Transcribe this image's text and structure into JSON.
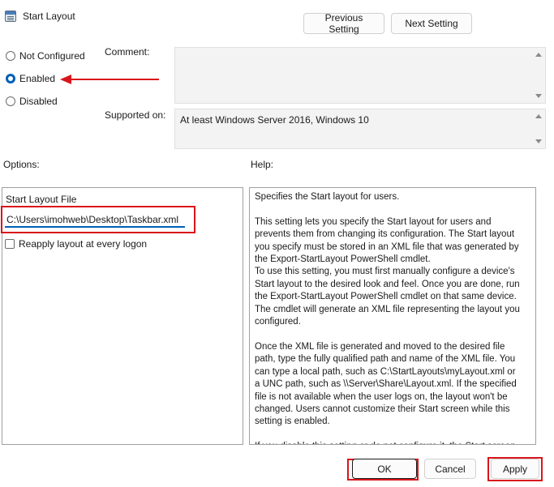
{
  "window": {
    "title": "Start Layout"
  },
  "nav": {
    "previous_label": "Previous Setting",
    "next_label": "Next Setting"
  },
  "state": {
    "options": [
      {
        "label": "Not Configured",
        "checked": false
      },
      {
        "label": "Enabled",
        "checked": true
      },
      {
        "label": "Disabled",
        "checked": false
      }
    ]
  },
  "comment": {
    "label": "Comment:",
    "value": ""
  },
  "supported": {
    "label": "Supported on:",
    "value": "At least Windows Server 2016, Windows 10"
  },
  "options_section": {
    "header": "Options:",
    "file_label": "Start Layout File",
    "file_value": "C:\\Users\\imohweb\\Desktop\\Taskbar.xml",
    "reapply_label": "Reapply layout at every logon"
  },
  "help_section": {
    "header": "Help:",
    "text": "Specifies the Start layout for users.\n\nThis setting lets you specify the Start layout for users and prevents them from changing its configuration. The Start layout you specify must be stored in an XML file that was generated by the Export-StartLayout PowerShell cmdlet.\nTo use this setting, you must first manually configure a device's Start layout to the desired look and feel. Once you are done, run the Export-StartLayout PowerShell cmdlet on that same device. The cmdlet will generate an XML file representing the layout you configured.\n\nOnce the XML file is generated and moved to the desired file path, type the fully qualified path and name of the XML file. You can type a local path, such as C:\\StartLayouts\\myLayout.xml or a UNC path, such as \\\\Server\\Share\\Layout.xml. If the specified file is not available when the user logs on, the layout won't be changed. Users cannot customize their Start screen while this setting is enabled.\n\nIf you disable this setting or do not configure it, the Start screen"
  },
  "footer": {
    "ok_label": "OK",
    "cancel_label": "Cancel",
    "apply_label": "Apply"
  },
  "colors": {
    "accent": "#005fb8",
    "annotation": "#d9151b"
  }
}
